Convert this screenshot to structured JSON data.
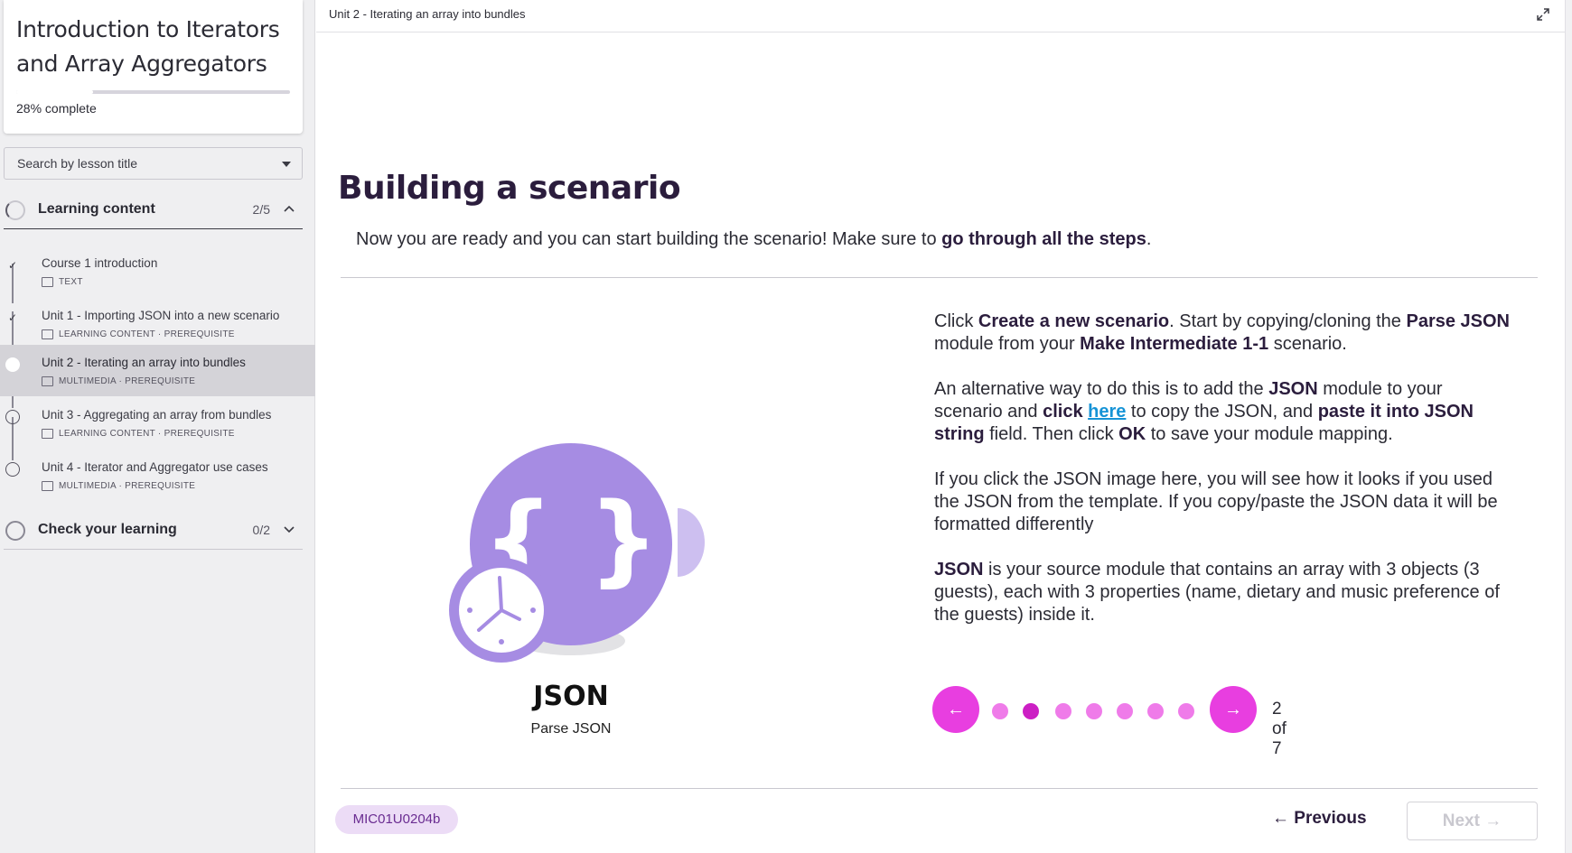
{
  "sidebar": {
    "course_title_line1": "Introduction to Iterators",
    "course_title_line2": "and Array Aggregators",
    "progress_percent": 28,
    "progress_value": "28%",
    "progress_suffix": " complete",
    "search_placeholder": "Search by lesson title",
    "sections": [
      {
        "title": "Learning content",
        "count": "2/5"
      },
      {
        "title": "Check your learning",
        "count": "0/2"
      }
    ],
    "lessons": [
      {
        "title": "Course 1 introduction",
        "meta": "TEXT",
        "status": "done"
      },
      {
        "title": "Unit 1 - Importing JSON into a new scenario",
        "meta": "LEARNING CONTENT · PREREQUISITE",
        "status": "done"
      },
      {
        "title": "Unit 2 - Iterating an array into bundles",
        "meta": "MULTIMEDIA · PREREQUISITE",
        "status": "current"
      },
      {
        "title": "Unit 3 - Aggregating an array from bundles",
        "meta": "LEARNING CONTENT · PREREQUISITE",
        "status": "open"
      },
      {
        "title": "Unit 4 - Iterator and Aggregator use cases",
        "meta": "MULTIMEDIA · PREREQUISITE",
        "status": "open"
      }
    ]
  },
  "topbar": {
    "breadcrumb": "Unit 2 - Iterating an array into bundles",
    "expand_icon": "expand-icon"
  },
  "main": {
    "heading": "Building a scenario",
    "intro_text": "Now you are ready and you can start building the scenario! Make sure to ",
    "intro_bold": "go through all the steps",
    "intro_end": ".",
    "module_name": "JSON",
    "module_subtitle": "Parse JSON",
    "p1": {
      "a": "Click ",
      "b": "Create a new scenario",
      "c": ". Start by copying/cloning the ",
      "d": "Parse JSON",
      "e": " module from your ",
      "f": "Make Intermediate 1-1",
      "g": " scenario."
    },
    "p2": {
      "a": "An alternative way to do this is to add the ",
      "b": "JSON",
      "c": " module to your scenario and ",
      "d": "click ",
      "link": "here",
      "e": " to copy the JSON, and ",
      "f": "paste it into JSON string",
      "g": " field. Then click ",
      "h": "OK",
      "i": " to save your module mapping."
    },
    "p3": "If you click the JSON image here, you will see how it looks if you used the JSON from the template. If you copy/paste the JSON data it will be formatted differently",
    "p4": {
      "a": "JSON",
      "b": " is your source module that contains an array with 3 objects (3 guests), each with 3 properties (name, dietary and music preference of the guests) inside it."
    },
    "pager": {
      "current": 2,
      "total": 7,
      "label": "2 of 7"
    }
  },
  "footer": {
    "code": "MIC01U0204b",
    "previous_label": "Previous",
    "next_label": "Next"
  },
  "colors": {
    "accent": "#e83ee0",
    "dot_active": "#cc1fc4",
    "module_purple": "#a68ce3",
    "link": "#1593d6"
  }
}
